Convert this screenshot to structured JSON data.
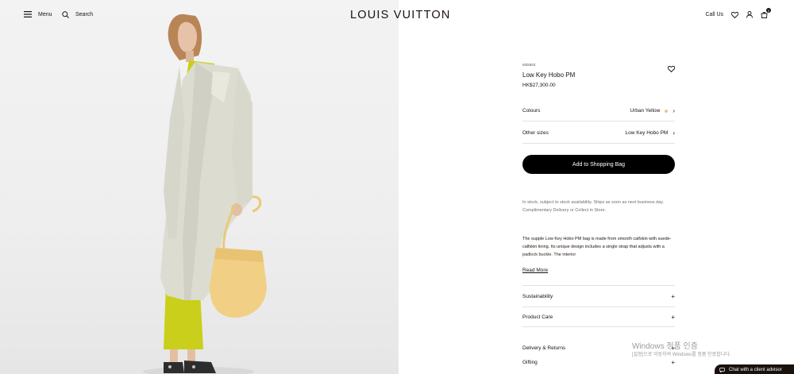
{
  "header": {
    "menu_label": "Menu",
    "search_label": "Search",
    "logo": "LOUIS VUITTON",
    "call_us": "Call Us",
    "cart_count": "0"
  },
  "product": {
    "sku": "M25553",
    "name": "Low Key Hobo PM",
    "price": "HK$27,300.00"
  },
  "options": {
    "colours_label": "Colours",
    "colours_value": "Urban Yellow",
    "colour_swatch": "#e9c77f",
    "sizes_label": "Other sizes",
    "sizes_value": "Low Key Hobo PM"
  },
  "actions": {
    "add_to_bag": "Add to Shopping Bag",
    "read_more": "Read More"
  },
  "stock_text": "In stock, subject to stock availability. Ships as soon as next business day. Complimentary Delivery or Collect in Store.",
  "description": "The supple Low Key Hobo PM bag is made from smooth calfskin with suede-calfskin lining. Its unique design includes a single strap that adjusts with a padlock buckle. The interior",
  "accordion": [
    {
      "label": "Sustainability"
    },
    {
      "label": "Product Care"
    },
    {
      "label": "Delivery & Returns"
    },
    {
      "label": "Gifting"
    }
  ],
  "watermark": {
    "line1": "Windows 정품 인증",
    "line2": "[설정]으로 이동하여 Windows를 정품 인증합니다."
  },
  "chat_label": "Chat with a client advisor"
}
